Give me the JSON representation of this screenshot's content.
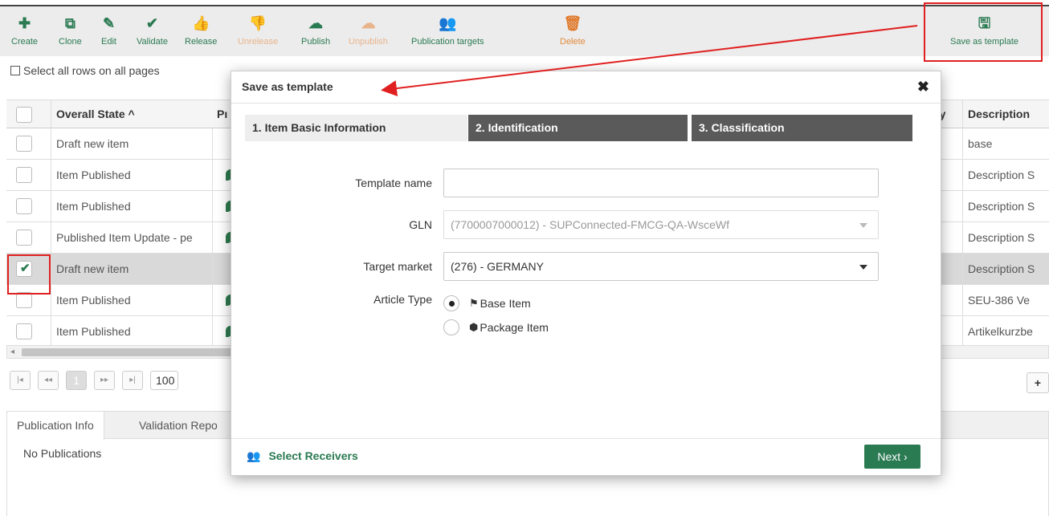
{
  "toolbar": {
    "create": "Create",
    "clone": "Clone",
    "edit": "Edit",
    "validate": "Validate",
    "release": "Release",
    "unrelease": "Unrelease",
    "publish": "Publish",
    "unpublish": "Unpublish",
    "publication_targets": "Publication targets",
    "delete": "Delete",
    "save_as_template": "Save as template"
  },
  "select_all": "Select all rows on all pages",
  "grid": {
    "headers": {
      "overall_state": "Overall State ^",
      "p": "Pı",
      "cntry": "ntry",
      "description": "Description"
    },
    "rows": [
      {
        "state": "Draft new item",
        "description": "base",
        "leaf": false,
        "selected": false
      },
      {
        "state": "Item Published",
        "description": "Description S",
        "leaf": true,
        "selected": false
      },
      {
        "state": "Item Published",
        "description": "Description S",
        "leaf": true,
        "selected": false
      },
      {
        "state": "Published Item Update - pe",
        "description": "Description S",
        "leaf": true,
        "selected": false
      },
      {
        "state": "Draft new item",
        "description": "Description S",
        "leaf": false,
        "selected": true
      },
      {
        "state": "Item Published",
        "description": "SEU-386 Ve",
        "leaf": true,
        "selected": false
      },
      {
        "state": "Item Published",
        "description": "Artikelkurzbe",
        "leaf": true,
        "selected": false
      }
    ]
  },
  "pager": {
    "first": "|◂",
    "prev": "◂◂",
    "page": "1",
    "next": "▸▸",
    "last": "▸|",
    "page_size": "100"
  },
  "bottom": {
    "tab_publication_info": "Publication Info",
    "tab_validation_report": "Validation Repo",
    "no_publications": "No Publications"
  },
  "modal": {
    "title": "Save as template",
    "close": "✖",
    "steps": [
      "1. Item Basic Information",
      "2. Identification",
      "3. Classification"
    ],
    "template_name_label": "Template name",
    "template_name_value": "",
    "gln_label": "GLN",
    "gln_value": "(7700007000012) - SUPConnected-FMCG-QA-WsceWf",
    "target_market_label": "Target market",
    "target_market_value": "(276) - GERMANY",
    "article_type_label": "Article Type",
    "article_options": [
      "Base Item",
      "Package Item"
    ],
    "article_selected_index": 0,
    "select_receivers": "Select Receivers",
    "next": "Next ›"
  },
  "colors": {
    "accent": "#2a7a52",
    "disabled": "#e8b48c",
    "annotation": "#e02020"
  }
}
